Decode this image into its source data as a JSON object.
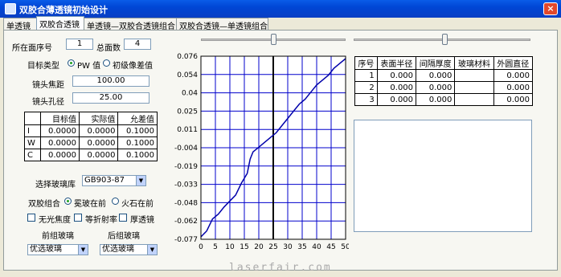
{
  "window": {
    "title": "双胶合薄透镜初始设计",
    "close": "×"
  },
  "tabs": [
    {
      "label": "单透镜",
      "active": false
    },
    {
      "label": "双胶合透镜",
      "active": true
    },
    {
      "label": "单透镜—双胶合透镜组合",
      "active": false
    },
    {
      "label": "双胶合透镜—单透镜组合",
      "active": false
    }
  ],
  "form": {
    "seq_label": "所在面序号",
    "seq_value": "1",
    "total_label": "总面数",
    "total_value": "4",
    "target_type_label": "目标类型",
    "target_opt1": "PW 值",
    "target_opt2": "初级像差值",
    "focal_label": "镜头焦距",
    "focal_value": "100.00",
    "aperture_label": "镜头孔径",
    "aperture_value": "25.00"
  },
  "target_table": {
    "headers": [
      "",
      "目标值",
      "实际值",
      "允差值"
    ],
    "rows": [
      [
        "I",
        "0.0000",
        "0.0000",
        "0.1000"
      ],
      [
        "W",
        "0.0000",
        "0.0000",
        "0.1000"
      ],
      [
        "C",
        "0.0000",
        "0.0000",
        "0.1000"
      ]
    ]
  },
  "glass": {
    "lib_label": "选择玻璃库",
    "lib_value": "GB903-87",
    "combo_label": "双胶组合",
    "combo_opt1": "冕玻在前",
    "combo_opt2": "火石在前",
    "chk1": "无光焦度",
    "chk2": "等折射率",
    "chk3": "厚透镜",
    "front_label": "前组玻璃",
    "back_label": "后组玻璃",
    "front_value": "优选玻璃",
    "back_value": "优选玻璃"
  },
  "chart_data": {
    "type": "line",
    "x_ticks": [
      "0",
      "5",
      "10",
      "15",
      "20",
      "25",
      "30",
      "35",
      "40",
      "45",
      "50"
    ],
    "y_ticks": [
      "0.076",
      "0.054",
      "0.04",
      "0.025",
      "0.011",
      "-0.004",
      "-0.019",
      "-0.033",
      "-0.048",
      "-0.062",
      "-0.077"
    ],
    "xlim": [
      0,
      50
    ],
    "ylim": [
      -0.077,
      0.076
    ],
    "marker_x": 25,
    "series": [
      {
        "x": [
          0,
          2,
          4,
          6,
          8,
          10,
          12,
          14,
          16,
          17,
          18,
          20,
          22,
          24,
          26,
          28,
          30,
          32,
          34,
          36,
          38,
          40,
          42,
          44,
          46,
          48,
          50
        ],
        "y": [
          -0.075,
          -0.07,
          -0.06,
          -0.056,
          -0.05,
          -0.045,
          -0.04,
          -0.03,
          -0.022,
          -0.01,
          -0.004,
          0.0,
          0.004,
          0.008,
          0.012,
          0.018,
          0.024,
          0.03,
          0.036,
          0.04,
          0.046,
          0.052,
          0.056,
          0.06,
          0.066,
          0.07,
          0.074
        ]
      }
    ]
  },
  "lens_table": {
    "headers": [
      "序号",
      "表面半径",
      "间隔厚度",
      "玻璃材料",
      "外圆直径"
    ],
    "rows": [
      [
        "1",
        "0.000",
        "0.000",
        "",
        "0.000"
      ],
      [
        "2",
        "0.000",
        "0.000",
        "",
        "0.000"
      ],
      [
        "3",
        "0.000",
        "0.000",
        "",
        "0.000"
      ]
    ]
  },
  "watermark": "laserfair.com"
}
